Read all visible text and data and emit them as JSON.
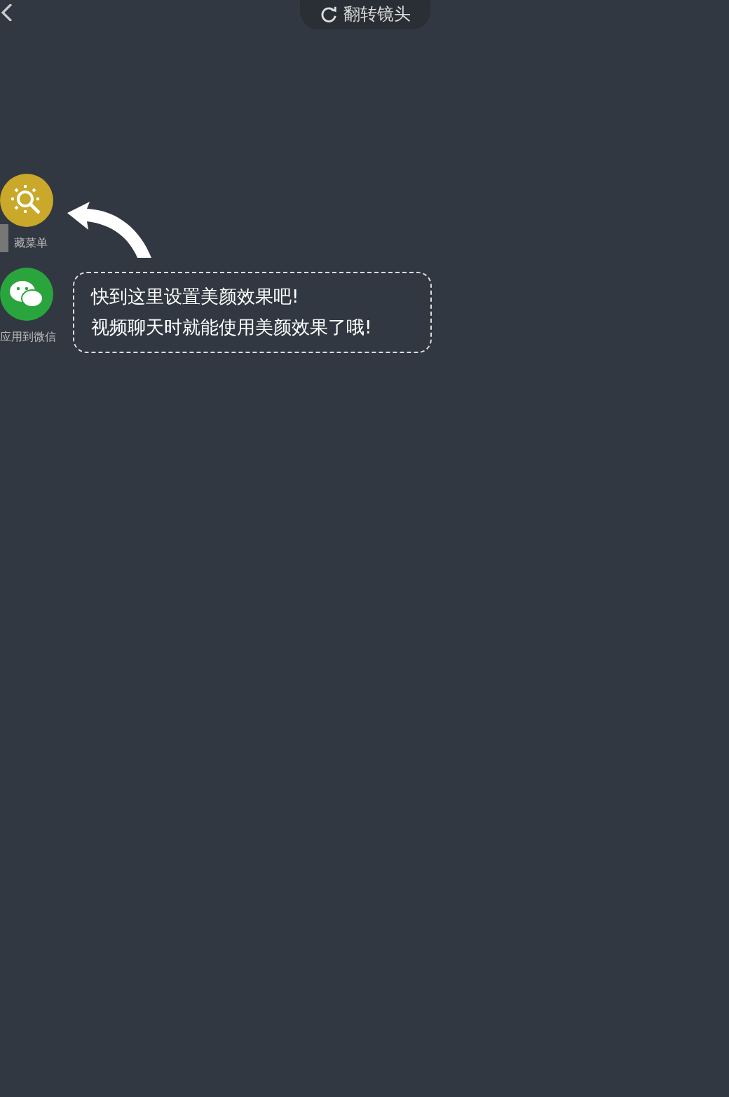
{
  "top_bar": {
    "flip_camera_button": "翻转镜头"
  },
  "side_menu": [
    {
      "kind": "beauty",
      "label": "藏菜单"
    },
    {
      "kind": "wechat",
      "label": "应用到微信"
    }
  ],
  "tip": {
    "lines": [
      "快到这里设置美颜效果吧!",
      "视频聊天时就能使用美颜效果了哦!"
    ]
  }
}
